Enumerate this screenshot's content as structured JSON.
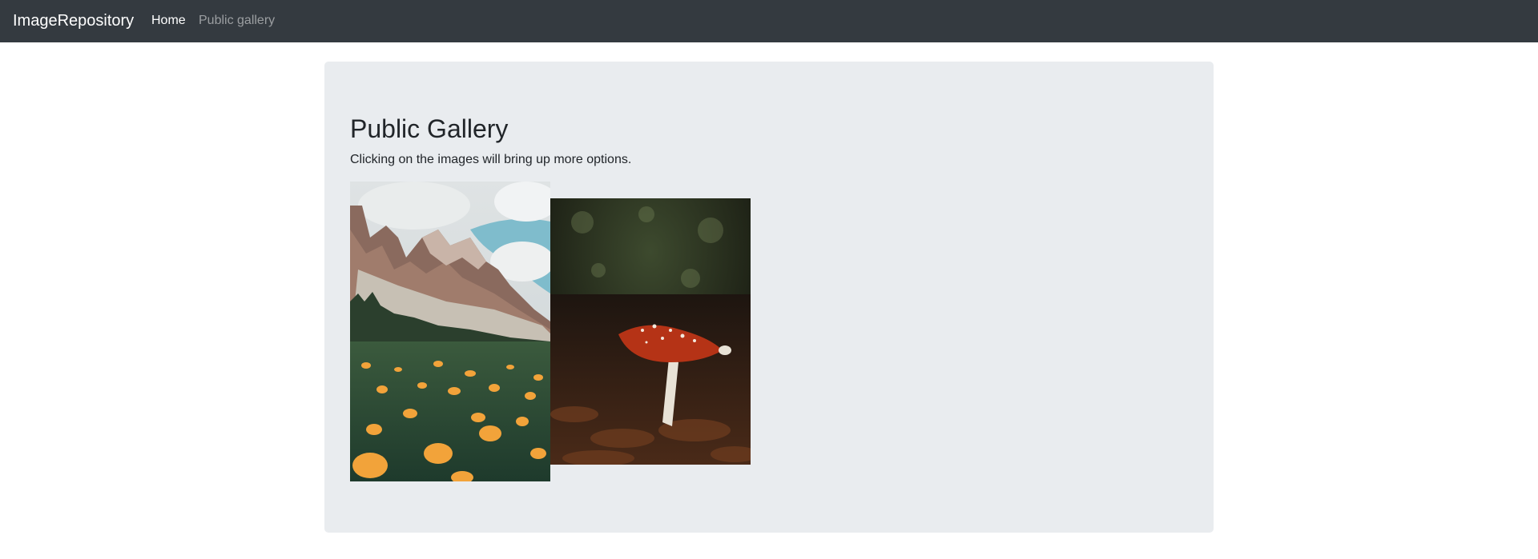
{
  "navbar": {
    "brand": "ImageRepository",
    "links": [
      {
        "label": "Home",
        "active": true
      },
      {
        "label": "Public gallery",
        "active": false
      }
    ]
  },
  "main": {
    "title": "Public Gallery",
    "subtitle": "Clicking on the images will bring up more options.",
    "images": [
      {
        "subject": "mountain-meadow-with-orange-flowers"
      },
      {
        "subject": "red-fly-agaric-mushroom-on-forest-floor"
      }
    ]
  },
  "colors": {
    "navbar_bg": "#343a40",
    "jumbotron_bg": "#e9ecef",
    "text": "#212529"
  }
}
